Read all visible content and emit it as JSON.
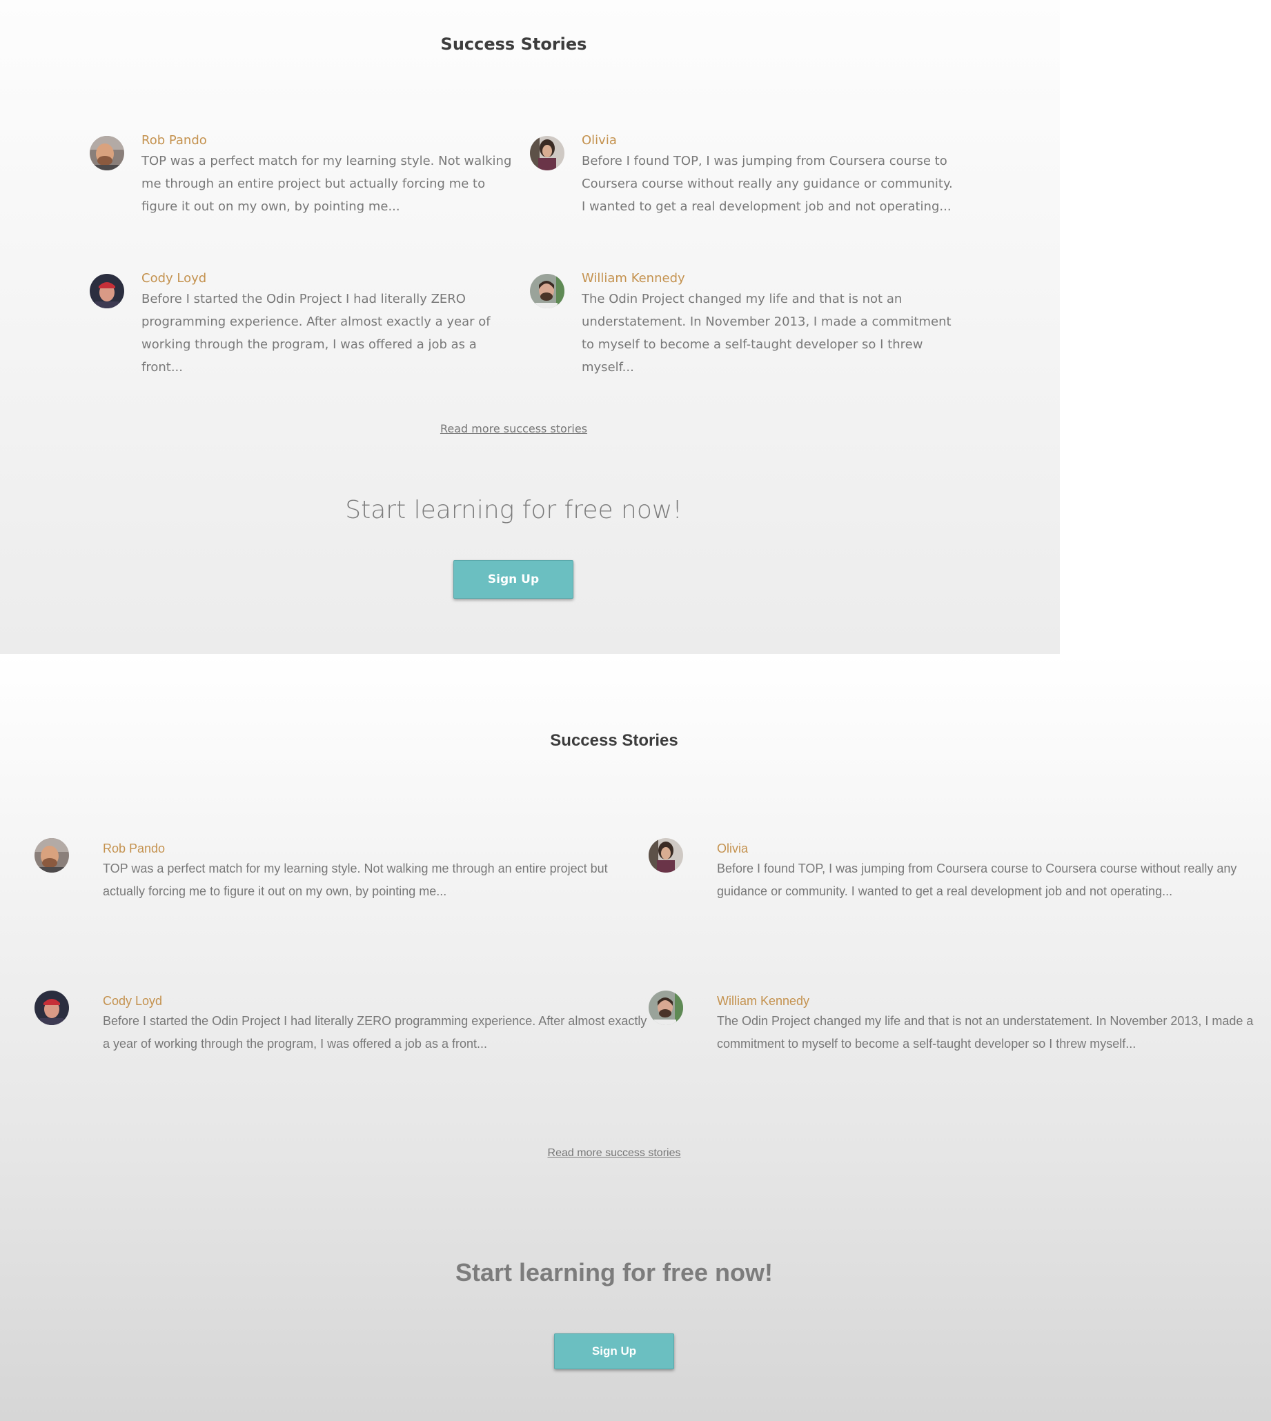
{
  "section": {
    "title": "Success Stories",
    "read_more": "Read more success stories",
    "cta": "Start learning for free now!",
    "signup_label": "Sign Up"
  },
  "stories": [
    {
      "name": "Rob Pando",
      "avatar": "rob-pando-avatar",
      "text": "TOP was a perfect match for my learning style. Not walking me through an entire project but actually forcing me to figure it out on my own, by pointing me..."
    },
    {
      "name": "Olivia",
      "avatar": "olivia-avatar",
      "text": "Before I found TOP, I was jumping from Coursera course to Coursera course without really any guidance or community. I wanted to get a real development job and not operating..."
    },
    {
      "name": "Cody Loyd",
      "avatar": "cody-loyd-avatar",
      "text": "Before I started the Odin Project I had literally ZERO programming experience. After almost exactly a year of working through the program, I was offered a job as a front..."
    },
    {
      "name": "William Kennedy",
      "avatar": "william-kennedy-avatar",
      "text": "The Odin Project changed my life and that is not an understatement. In November 2013, I made a commitment to myself to become a self-taught developer so I threw myself..."
    }
  ],
  "colors": {
    "name": "#c4924f",
    "button": "#6bbfc1",
    "body_text": "#787878",
    "heading": "#3c3c3c"
  }
}
